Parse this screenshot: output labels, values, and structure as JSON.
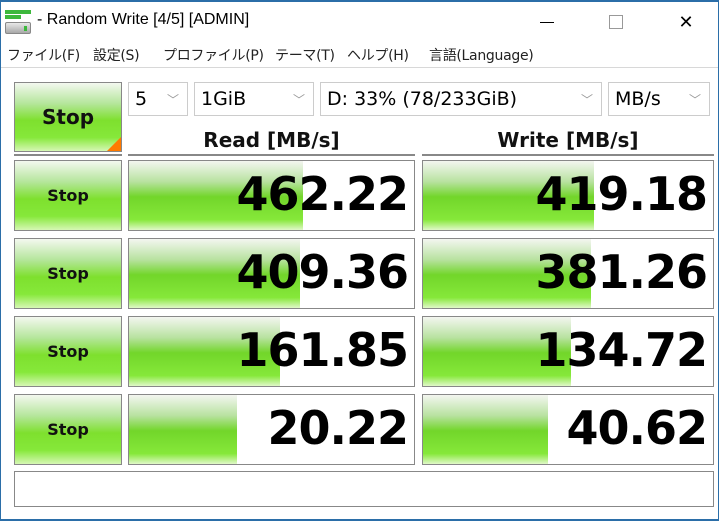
{
  "window": {
    "title": "- Random Write [4/5] [ADMIN]",
    "controls": {
      "minimize": "minimize",
      "maximize": "maximize",
      "close": "close"
    }
  },
  "menu": [
    {
      "label": "ファイル(F)"
    },
    {
      "label": "設定(S)"
    },
    {
      "label": "プロファイル(P)"
    },
    {
      "label": "テーマ(T)"
    },
    {
      "label": "ヘルプ(H)"
    },
    {
      "label": "言語(Language)"
    }
  ],
  "toolbar": {
    "main_button_label": "Stop",
    "count": "5",
    "size": "1GiB",
    "drive": "D: 33% (78/233GiB)",
    "unit": "MB/s"
  },
  "columns": {
    "read": "Read [MB/s]",
    "write": "Write [MB/s]"
  },
  "colors": {
    "bar_green": "#86e83a",
    "corner_orange": "#ff7a00",
    "border": "#888888"
  },
  "rows": [
    {
      "button": "Stop",
      "read": "462.22",
      "read_fill": 0.61,
      "write": "419.18",
      "write_fill": 0.59
    },
    {
      "button": "Stop",
      "read": "409.36",
      "read_fill": 0.6,
      "write": "381.26",
      "write_fill": 0.58
    },
    {
      "button": "Stop",
      "read": "161.85",
      "read_fill": 0.53,
      "write": "134.72",
      "write_fill": 0.51
    },
    {
      "button": "Stop",
      "read": "20.22",
      "read_fill": 0.38,
      "write": "40.62",
      "write_fill": 0.43
    }
  ],
  "status": {
    "text": ""
  }
}
